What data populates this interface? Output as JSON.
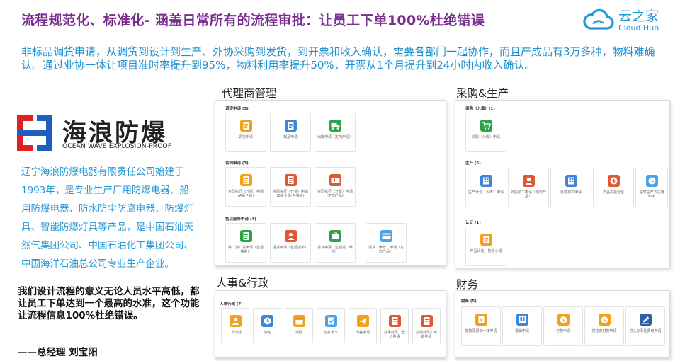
{
  "header": {
    "title": "流程规范化、标准化- 涵盖日常所有的流程审批：让员工下单100%杜绝错误",
    "brand_cn": "云之家",
    "brand_en": "Cloud Hub"
  },
  "intro": "非标品调货申请，从调货到设计到生产、外协采购到发货，到开票和收入确认，需要各部门一起协作，而且产成品有3万多种，物料难确认。通过业协一体让项目准时率提升到95%，物料利用率提升50%，开票从1个月提升到24小时内收入确认。",
  "company": {
    "name_cn": "海浪防爆",
    "name_en": "OCEAN WAVE EXPLOSION-PROOF",
    "description": "辽宁海浪防爆电器有限责任公司始建于1993年，是专业生产厂用防爆电器、船用防爆电器、防水防尘防腐电器、防爆灯具、智能防爆灯具等产品，是中国石油天然气集团公司、中国石油化工集团公司、中国海洋石油总公司专业生产企业。",
    "quote": "我们设计流程的意义无论人员水平高低，都让员工下单达到一个最高的水准，这个功能让流程信息100%杜绝错误。",
    "quote_author": "——总经理 刘宝阳"
  },
  "colors": {
    "title": "#7a2c8f",
    "intro": "#1f8fce",
    "orange": "#f2a11f",
    "blue": "#3d86d6",
    "green": "#2ea345",
    "red": "#e05734"
  },
  "panels": {
    "agent": {
      "label": "代理商管理",
      "groups": [
        {
          "title": "调货申请 (3)",
          "items": [
            {
              "label": "调货申请",
              "icon": "document-icon",
              "color": "orange"
            },
            {
              "label": "样品申请",
              "icon": "document-icon",
              "color": "blue"
            },
            {
              "label": "出库申请（定向产品）",
              "icon": "truck-icon",
              "color": "green"
            }
          ]
        },
        {
          "title": "合同申请 (3)",
          "items": [
            {
              "label": "合同执行（开票）申请 (A版全体)",
              "icon": "document-icon",
              "color": "orange"
            },
            {
              "label": "合同执行（开票）申请 (B版全体-办事处)",
              "icon": "document-icon",
              "color": "red"
            },
            {
              "label": "合同执行（开票）申请（定向产品）",
              "icon": "ticket-icon",
              "color": "red"
            }
          ]
        },
        {
          "title": "售后服务申请 (4)",
          "items": [
            {
              "label": "补（退）货申请（售后换新）",
              "icon": "document-icon",
              "color": "green"
            },
            {
              "label": "退货申请（售后退单）",
              "icon": "person-icon",
              "color": "red"
            },
            {
              "label": "退货申请（售后返厂维修）",
              "icon": "toolbox-icon",
              "color": "green"
            },
            {
              "label": "退货（维修）申请（定向产品）",
              "icon": "card-icon",
              "color": "lightblue"
            }
          ]
        }
      ]
    },
    "purchase": {
      "label": "采购&生产",
      "groups": [
        {
          "title": "采购（入库）(1)",
          "items": [
            {
              "label": "采购（入库）申请",
              "icon": "cart-icon",
              "color": "green"
            }
          ]
        },
        {
          "title": "生产 (5)",
          "items": [
            {
              "label": "生产计划（入库）申请",
              "icon": "grid-icon",
              "color": "blue"
            },
            {
              "label": "外协加工申请（定向产品）",
              "icon": "person-icon",
              "color": "red"
            },
            {
              "label": "外协加工申请",
              "icon": "grid-icon",
              "color": "blue"
            },
            {
              "label": "产品实验记录",
              "icon": "star-icon",
              "color": "red"
            },
            {
              "label": "临时生产下达通知单",
              "icon": "clock-icon",
              "color": "lightblue"
            }
          ]
        },
        {
          "title": "认证 (1)",
          "items": [
            {
              "label": "产品认证、检验小组",
              "icon": "document-icon",
              "color": "orange"
            }
          ]
        }
      ]
    },
    "hr": {
      "label": "人事&行政",
      "groups": [
        {
          "title": "人事行政 (7)",
          "items": [
            {
              "label": "工作日志",
              "icon": "person-icon",
              "color": "orange"
            },
            {
              "label": "加班",
              "icon": "clock-icon",
              "color": "blue"
            },
            {
              "label": "请假",
              "icon": "calendar-icon",
              "color": "orange"
            },
            {
              "label": "忘打卡卡",
              "icon": "check-icon",
              "color": "lightblue"
            },
            {
              "label": "出差申请",
              "icon": "plane-icon",
              "color": "orange"
            },
            {
              "label": "办事处员工登记申请",
              "icon": "document-icon",
              "color": "red"
            },
            {
              "label": "办事处员工离职申请",
              "icon": "document-icon",
              "color": "red"
            }
          ]
        }
      ]
    },
    "finance": {
      "label": "财务",
      "groups": [
        {
          "title": "财务 (5)",
          "items": [
            {
              "label": "借款及报销一体申请",
              "icon": "receipt-icon",
              "color": "orange"
            },
            {
              "label": "报销申请",
              "icon": "grid-icon",
              "color": "blue"
            },
            {
              "label": "付款申请",
              "icon": "money-icon",
              "color": "orange"
            },
            {
              "label": "供应商付款申请",
              "icon": "money-icon",
              "color": "orange"
            },
            {
              "label": "进入办事处费用申请",
              "icon": "pen-icon",
              "color": "navy"
            }
          ]
        }
      ]
    }
  }
}
